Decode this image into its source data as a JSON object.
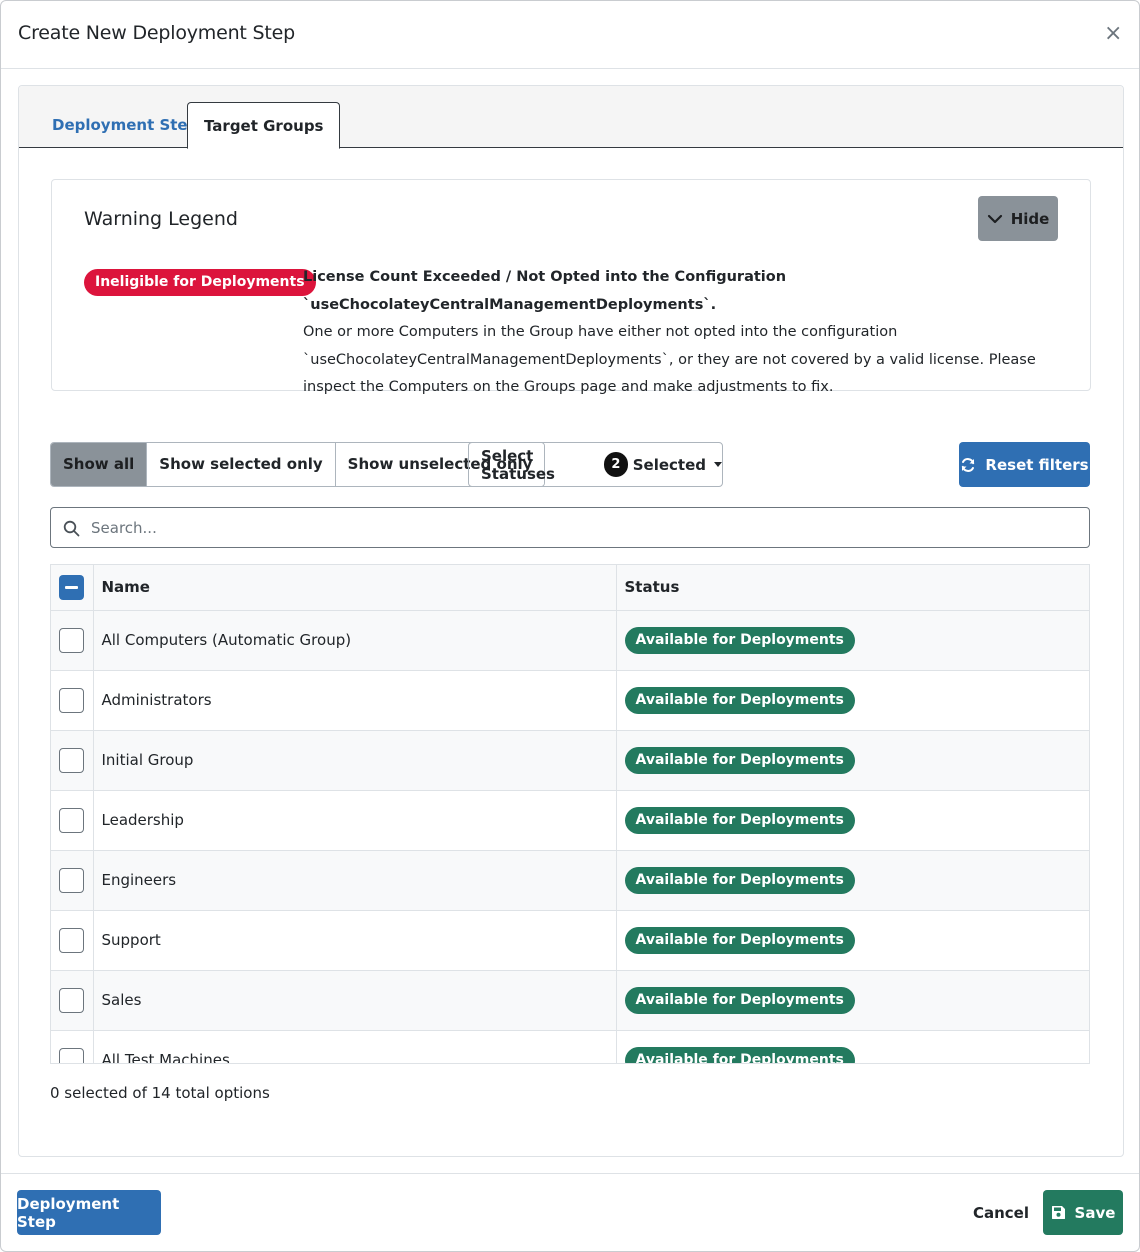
{
  "modal": {
    "title": "Create New Deployment Step",
    "close_symbol": "×"
  },
  "tabs": [
    {
      "label": "Deployment Step",
      "active": false
    },
    {
      "label": "Target Groups",
      "active": true
    }
  ],
  "legend": {
    "title": "Warning Legend",
    "hide_label": "Hide",
    "hide_icon": "chevron-down-icon",
    "badge_label": "Ineligible for Deployments",
    "badge_color": "#dc143c",
    "heading": "License Count Exceeded / Not Opted into the Configuration `useChocolateyCentralManagementDeployments`.",
    "description": "One or more Computers in the Group have either not opted into the configuration `useChocolateyCentralManagementDeployments`, or they are not covered by a valid license. Please inspect the Computers on the Groups page and make adjustments to fix."
  },
  "filters": {
    "options": [
      "Show all",
      "Show selected only",
      "Show unselected only"
    ],
    "active": "Show all",
    "status_label": "Select Statuses",
    "status_count": "2",
    "status_selected_label": "Selected",
    "reset_label": "Reset filters",
    "reset_icon": "refresh-icon"
  },
  "search": {
    "placeholder": "Search...",
    "value": "",
    "icon": "search-icon"
  },
  "table": {
    "columns": [
      "Name",
      "Status"
    ],
    "status_color": "#237a5f",
    "rows": [
      {
        "name": "All Computers (Automatic Group)",
        "status": "Available for Deployments",
        "checked": false
      },
      {
        "name": "Administrators",
        "status": "Available for Deployments",
        "checked": false
      },
      {
        "name": "Initial Group",
        "status": "Available for Deployments",
        "checked": false
      },
      {
        "name": "Leadership",
        "status": "Available for Deployments",
        "checked": false
      },
      {
        "name": "Engineers",
        "status": "Available for Deployments",
        "checked": false
      },
      {
        "name": "Support",
        "status": "Available for Deployments",
        "checked": false
      },
      {
        "name": "Sales",
        "status": "Available for Deployments",
        "checked": false
      },
      {
        "name": "All Test Machines",
        "status": "Available for Deployments",
        "checked": false
      }
    ]
  },
  "selection_summary": "0 selected of 14 total options",
  "footer": {
    "deployment_step_label": "Deployment Step",
    "cancel_label": "Cancel",
    "save_label": "Save",
    "save_icon": "floppy-disk-icon"
  },
  "colors": {
    "primary": "#2f6fb3",
    "success": "#237a5f",
    "danger": "#dc143c",
    "secondary": "#8a9299"
  }
}
